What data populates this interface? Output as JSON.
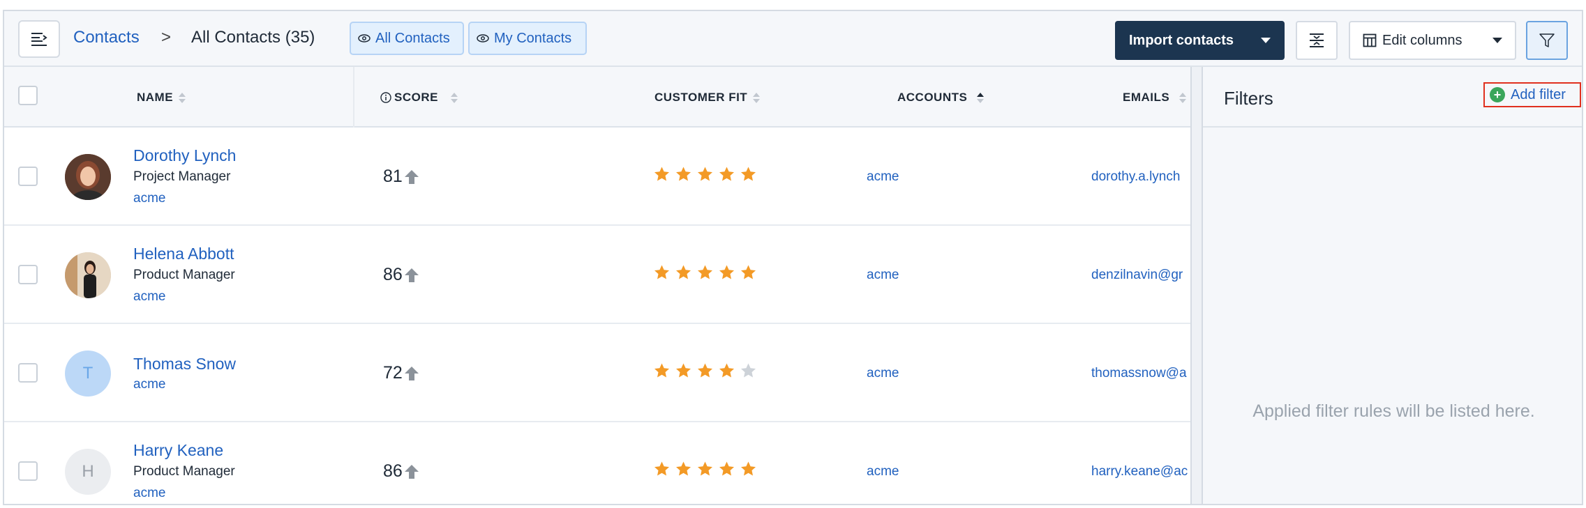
{
  "header": {
    "breadcrumb_root": "Contacts",
    "breadcrumb_separator": ">",
    "breadcrumb_current": "All Contacts",
    "count": "(35)",
    "view_all": "All Contacts",
    "view_mine": "My Contacts",
    "import_label": "Import contacts",
    "edit_columns_label": "Edit columns"
  },
  "table": {
    "columns": [
      "NAME",
      "SCORE",
      "CUSTOMER FIT",
      "ACCOUNTS",
      "EMAILS"
    ],
    "rows": [
      {
        "name": "Dorothy Lynch",
        "title": "Project Manager",
        "account_small": "acme",
        "score": "81",
        "stars": 5,
        "account": "acme",
        "email": "dorothy.a.lynch",
        "avatar": "photo"
      },
      {
        "name": "Helena Abbott",
        "title": "Product Manager",
        "account_small": "acme",
        "score": "86",
        "stars": 5,
        "account": "acme",
        "email": "denzilnavin@gr",
        "avatar": "photo"
      },
      {
        "name": "Thomas Snow",
        "title": "",
        "account_small": "acme",
        "score": "72",
        "stars": 4,
        "account": "acme",
        "email": "thomassnow@a",
        "avatar": "T"
      },
      {
        "name": "Harry Keane",
        "title": "Product Manager",
        "account_small": "acme",
        "score": "86",
        "stars": 5,
        "account": "acme",
        "email": "harry.keane@ac",
        "avatar": "H"
      }
    ]
  },
  "filters": {
    "title": "Filters",
    "add_label": "Add filter",
    "empty_message": "Applied filter rules will be listed here."
  },
  "colors": {
    "link": "#2161bf",
    "star_on": "#f39a26",
    "star_off": "#cdd2d8",
    "import_bg": "#1c3550",
    "highlight": "#e0301e"
  }
}
